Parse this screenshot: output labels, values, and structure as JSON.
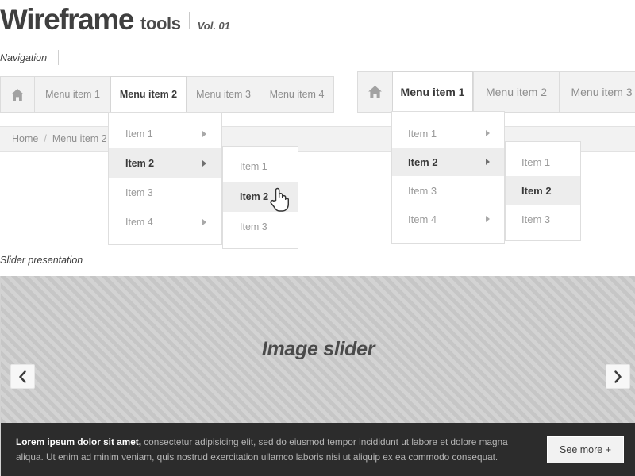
{
  "masthead": {
    "logo_main": "Wireframe",
    "logo_sub": "tools",
    "volume": "Vol. 01"
  },
  "sections": {
    "navigation_label": "Navigation",
    "slider_label": "Slider presentation"
  },
  "nav_left": {
    "home_icon": "home-icon",
    "tabs": [
      {
        "label": "Menu item 1",
        "active": false
      },
      {
        "label": "Menu item 2",
        "active": true
      },
      {
        "label": "Menu item 3",
        "active": false
      },
      {
        "label": "Menu item 4",
        "active": false
      }
    ]
  },
  "nav_right": {
    "home_icon": "home-icon",
    "tabs": [
      {
        "label": "Menu item 1",
        "active": true
      },
      {
        "label": "Menu item 2",
        "active": false
      },
      {
        "label": "Menu item 3",
        "active": false
      }
    ]
  },
  "breadcrumb": {
    "home": "Home",
    "separator": "/",
    "current": "Menu item 2"
  },
  "dropdown_left_level1": {
    "items": [
      {
        "label": "Item 1",
        "selected": false,
        "has_submenu": true
      },
      {
        "label": "Item 2",
        "selected": true,
        "has_submenu": true
      },
      {
        "label": "Item 3",
        "selected": false,
        "has_submenu": false
      },
      {
        "label": "Item 4",
        "selected": false,
        "has_submenu": true
      }
    ]
  },
  "dropdown_left_level2": {
    "items": [
      {
        "label": "Item 1",
        "selected": false
      },
      {
        "label": "Item 2",
        "selected": true
      },
      {
        "label": "Item 3",
        "selected": false
      }
    ]
  },
  "dropdown_right_level1": {
    "items": [
      {
        "label": "Item 1",
        "selected": false,
        "has_submenu": true
      },
      {
        "label": "Item 2",
        "selected": true,
        "has_submenu": true
      },
      {
        "label": "Item 3",
        "selected": false,
        "has_submenu": false
      },
      {
        "label": "Item 4",
        "selected": false,
        "has_submenu": true
      }
    ]
  },
  "dropdown_right_level2": {
    "items": [
      {
        "label": "Item 1",
        "selected": false
      },
      {
        "label": "Item 2",
        "selected": true
      },
      {
        "label": "Item 3",
        "selected": false
      }
    ]
  },
  "cursor": {
    "icon": "pointer-hand-cursor"
  },
  "slider": {
    "title": "Image slider",
    "prev_icon": "chevron-left-icon",
    "next_icon": "chevron-right-icon",
    "caption_bold": "Lorem ipsum dolor sit amet,",
    "caption_rest": " consectetur adipisicing elit, sed do eiusmod tempor incididunt ut labore et dolore magna aliqua. Ut enim ad minim veniam, quis nostrud exercitation ullamco laboris nisi ut aliquip ex ea commodo consequat.",
    "see_more_label": "See more +"
  },
  "colors": {
    "tab_inactive_bg": "#f2f2f2",
    "tab_active_bg": "#ffffff",
    "menu_selected_bg": "#ededed",
    "caption_bg": "#2c2c2c",
    "hatch_light": "#d3d3d3",
    "hatch_dark": "#c6c6c6"
  }
}
